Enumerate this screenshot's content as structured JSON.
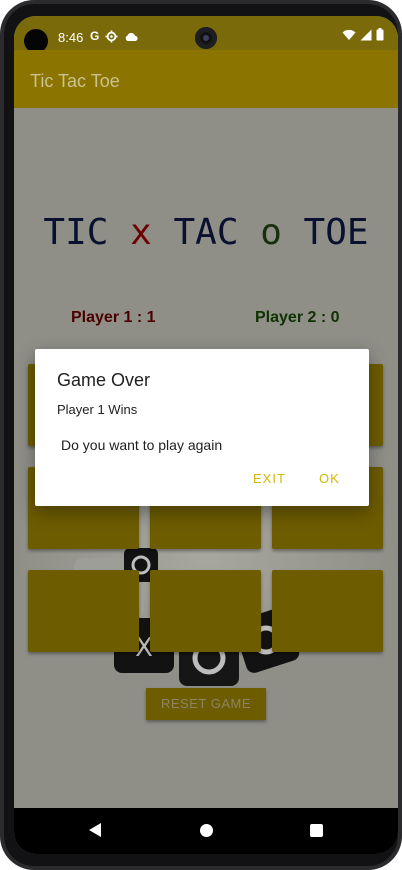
{
  "status_bar": {
    "time": "8:46",
    "icons_left": [
      "google-g-icon",
      "settings-icon",
      "cloud-icon"
    ],
    "icons_right": [
      "wifi-icon",
      "signal-icon",
      "battery-icon"
    ]
  },
  "app_bar": {
    "title": "Tic Tac Toe"
  },
  "logo": {
    "part1": "TIC ",
    "x": "x",
    "part2": " TAC ",
    "o": "o",
    "part3": " TOE"
  },
  "scores": {
    "player1": "Player 1 : 1",
    "player2": "Player 2 : 0"
  },
  "board": {
    "cells": [
      "",
      "",
      "",
      "",
      "",
      "",
      "",
      "",
      ""
    ]
  },
  "reset_button": {
    "label": "RESET GAME"
  },
  "dialog": {
    "title": "Game Over",
    "subtitle": "Player 1 Wins",
    "message": "Do you want to play again",
    "exit_label": "EXIT",
    "ok_label": "OK"
  },
  "colors": {
    "accent": "#d4b700",
    "app_bar": "#8b7400",
    "cell": "#6d5c00",
    "player1": "#8b0000",
    "player2": "#1c5c00"
  }
}
